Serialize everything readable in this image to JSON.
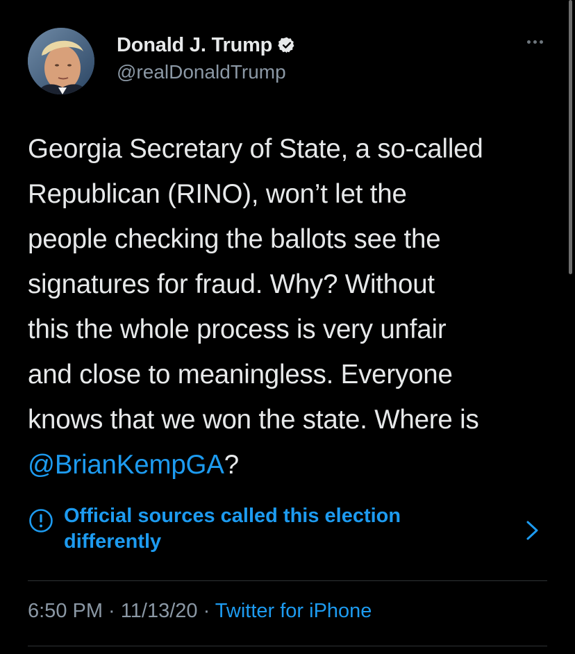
{
  "user": {
    "display_name": "Donald J. Trump",
    "handle": "@realDonaldTrump",
    "verified": true
  },
  "tweet": {
    "lines": [
      "Georgia Secretary of State, a so-called",
      "Republican (RINO), won’t let the",
      "people checking the ballots see the",
      "signatures for fraud. Why? Without",
      "this the whole process is very unfair",
      "and close to meaningless. Everyone",
      "knows that we won the state. Where is"
    ],
    "mention": "@BrianKempGA",
    "after_mention": "?"
  },
  "notice": {
    "line1": "Official sources called this election",
    "line2": "differently",
    "icon": "exclamation-circle-icon"
  },
  "meta": {
    "time": "6:50 PM",
    "sep1": " · ",
    "date": "11/13/20",
    "sep2": " · ",
    "source": "Twitter for iPhone"
  },
  "colors": {
    "background": "#000000",
    "text": "#e7e9ea",
    "secondary": "#8b98a5",
    "link": "#1d9bf0",
    "divider": "#2f3336"
  }
}
